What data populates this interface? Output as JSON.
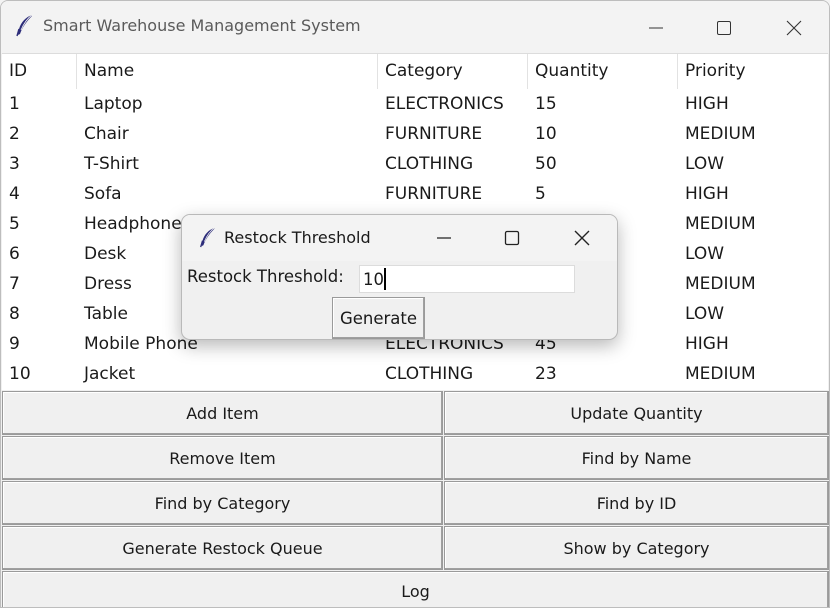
{
  "window": {
    "title": "Smart Warehouse Management System"
  },
  "table": {
    "columns": [
      "ID",
      "Name",
      "Category",
      "Quantity",
      "Priority"
    ],
    "rows": [
      [
        "1",
        "Laptop",
        "ELECTRONICS",
        "15",
        "HIGH"
      ],
      [
        "2",
        "Chair",
        "FURNITURE",
        "10",
        "MEDIUM"
      ],
      [
        "3",
        "T-Shirt",
        "CLOTHING",
        "50",
        "LOW"
      ],
      [
        "4",
        "Sofa",
        "FURNITURE",
        "5",
        "HIGH"
      ],
      [
        "5",
        "Headphone",
        "",
        "",
        "MEDIUM"
      ],
      [
        "6",
        "Desk",
        "",
        "",
        "LOW"
      ],
      [
        "7",
        "Dress",
        "",
        "",
        "MEDIUM"
      ],
      [
        "8",
        "Table",
        "",
        "",
        "LOW"
      ],
      [
        "9",
        "Mobile Phone",
        "ELECTRONICS",
        "45",
        "HIGH"
      ],
      [
        "10",
        "Jacket",
        "CLOTHING",
        "23",
        "MEDIUM"
      ]
    ]
  },
  "buttons": {
    "add_item": "Add Item",
    "update_quantity": "Update Quantity",
    "remove_item": "Remove Item",
    "find_by_name": "Find by Name",
    "find_by_category": "Find by Category",
    "find_by_id": "Find by ID",
    "generate_restock_queue": "Generate Restock Queue",
    "show_by_category": "Show by Category",
    "log": "Log"
  },
  "dialog": {
    "title": "Restock Threshold",
    "label": "Restock Threshold:",
    "input_value": "10",
    "button_label": "Generate"
  },
  "icons": {
    "app": "feather-icon",
    "minimize": "minimize-icon",
    "maximize": "maximize-icon",
    "close": "close-icon"
  },
  "colors": {
    "window_bg": "#f0f0f0",
    "table_bg": "#ffffff",
    "text": "#1a1a1a"
  }
}
